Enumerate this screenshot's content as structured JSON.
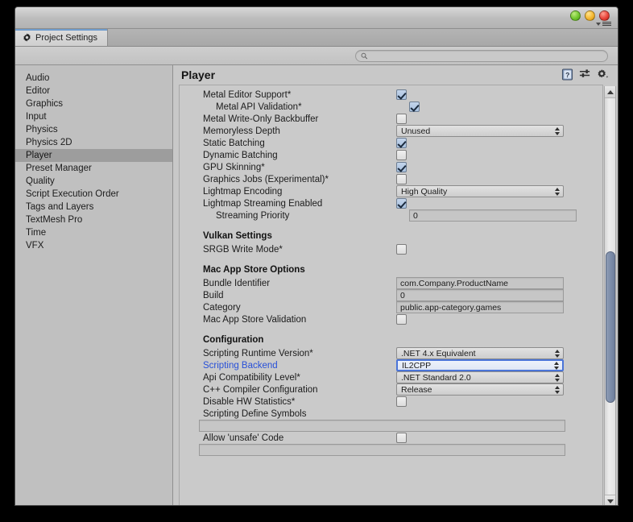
{
  "window": {
    "tab_label": "Project Settings",
    "tab_icon": "gear-icon",
    "traffic_lights": [
      "green",
      "yellow",
      "red"
    ],
    "menu_icon": "hamburger-menu-icon"
  },
  "search": {
    "value": "",
    "placeholder": "",
    "icon": "search-icon"
  },
  "sidebar": {
    "items": [
      {
        "label": "Audio",
        "selected": false
      },
      {
        "label": "Editor",
        "selected": false
      },
      {
        "label": "Graphics",
        "selected": false
      },
      {
        "label": "Input",
        "selected": false
      },
      {
        "label": "Physics",
        "selected": false
      },
      {
        "label": "Physics 2D",
        "selected": false
      },
      {
        "label": "Player",
        "selected": true
      },
      {
        "label": "Preset Manager",
        "selected": false
      },
      {
        "label": "Quality",
        "selected": false
      },
      {
        "label": "Script Execution Order",
        "selected": false
      },
      {
        "label": "Tags and Layers",
        "selected": false
      },
      {
        "label": "TextMesh Pro",
        "selected": false
      },
      {
        "label": "Time",
        "selected": false
      },
      {
        "label": "VFX",
        "selected": false
      }
    ]
  },
  "main": {
    "title": "Player",
    "header_icons": [
      {
        "name": "help-icon",
        "label": "?"
      },
      {
        "name": "preset-icon",
        "label": ""
      },
      {
        "name": "settings-gear-icon",
        "label": ""
      }
    ],
    "rows": [
      {
        "type": "checkbox",
        "label": "Metal Editor Support*",
        "value": true,
        "indent": false
      },
      {
        "type": "checkbox",
        "label": "Metal API Validation*",
        "value": true,
        "indent": true
      },
      {
        "type": "checkbox",
        "label": "Metal Write-Only Backbuffer",
        "value": false,
        "indent": false
      },
      {
        "type": "dropdown",
        "label": "Memoryless Depth",
        "value": "Unused",
        "indent": false
      },
      {
        "type": "checkbox",
        "label": "Static Batching",
        "value": true,
        "indent": false
      },
      {
        "type": "checkbox",
        "label": "Dynamic Batching",
        "value": false,
        "indent": false
      },
      {
        "type": "checkbox",
        "label": "GPU Skinning*",
        "value": true,
        "indent": false
      },
      {
        "type": "checkbox",
        "label": "Graphics Jobs (Experimental)*",
        "value": false,
        "indent": false
      },
      {
        "type": "dropdown",
        "label": "Lightmap Encoding",
        "value": "High Quality",
        "indent": false
      },
      {
        "type": "checkbox",
        "label": "Lightmap Streaming Enabled",
        "value": true,
        "indent": false
      },
      {
        "type": "textfield",
        "label": "Streaming Priority",
        "value": "0",
        "indent": true
      },
      {
        "type": "section",
        "label": "Vulkan Settings"
      },
      {
        "type": "checkbox",
        "label": "SRGB Write Mode*",
        "value": false,
        "indent": false
      },
      {
        "type": "section",
        "label": "Mac App Store Options"
      },
      {
        "type": "textfield",
        "label": "Bundle Identifier",
        "value": "com.Company.ProductName",
        "indent": false
      },
      {
        "type": "textfield",
        "label": "Build",
        "value": "0",
        "indent": false
      },
      {
        "type": "textfield",
        "label": "Category",
        "value": "public.app-category.games",
        "indent": false
      },
      {
        "type": "checkbox",
        "label": "Mac App Store Validation",
        "value": false,
        "indent": false
      },
      {
        "type": "section",
        "label": "Configuration"
      },
      {
        "type": "dropdown",
        "label": "Scripting Runtime Version*",
        "value": ".NET 4.x Equivalent",
        "indent": false
      },
      {
        "type": "dropdown",
        "label": "Scripting Backend",
        "value": "IL2CPP",
        "indent": false,
        "highlighted": true
      },
      {
        "type": "dropdown",
        "label": "Api Compatibility Level*",
        "value": ".NET Standard 2.0",
        "indent": false
      },
      {
        "type": "dropdown",
        "label": "C++ Compiler Configuration",
        "value": "Release",
        "indent": false
      },
      {
        "type": "checkbox",
        "label": "Disable HW Statistics*",
        "value": false,
        "indent": false
      },
      {
        "type": "label-only",
        "label": "Scripting Define Symbols"
      },
      {
        "type": "fullwidth-text",
        "label": "",
        "value": ""
      },
      {
        "type": "checkbox",
        "label": "Allow 'unsafe' Code",
        "value": false,
        "indent": false
      },
      {
        "type": "fullwidth-text-partial",
        "label": "",
        "value": ""
      }
    ]
  },
  "colors": {
    "accent_blue": "#2850d8",
    "focus_border": "#4a74d8",
    "selection_gray": "#9d9d9d",
    "scrollbar_thumb": "#7f8fab",
    "tab_accent": "#6f9ccd"
  }
}
